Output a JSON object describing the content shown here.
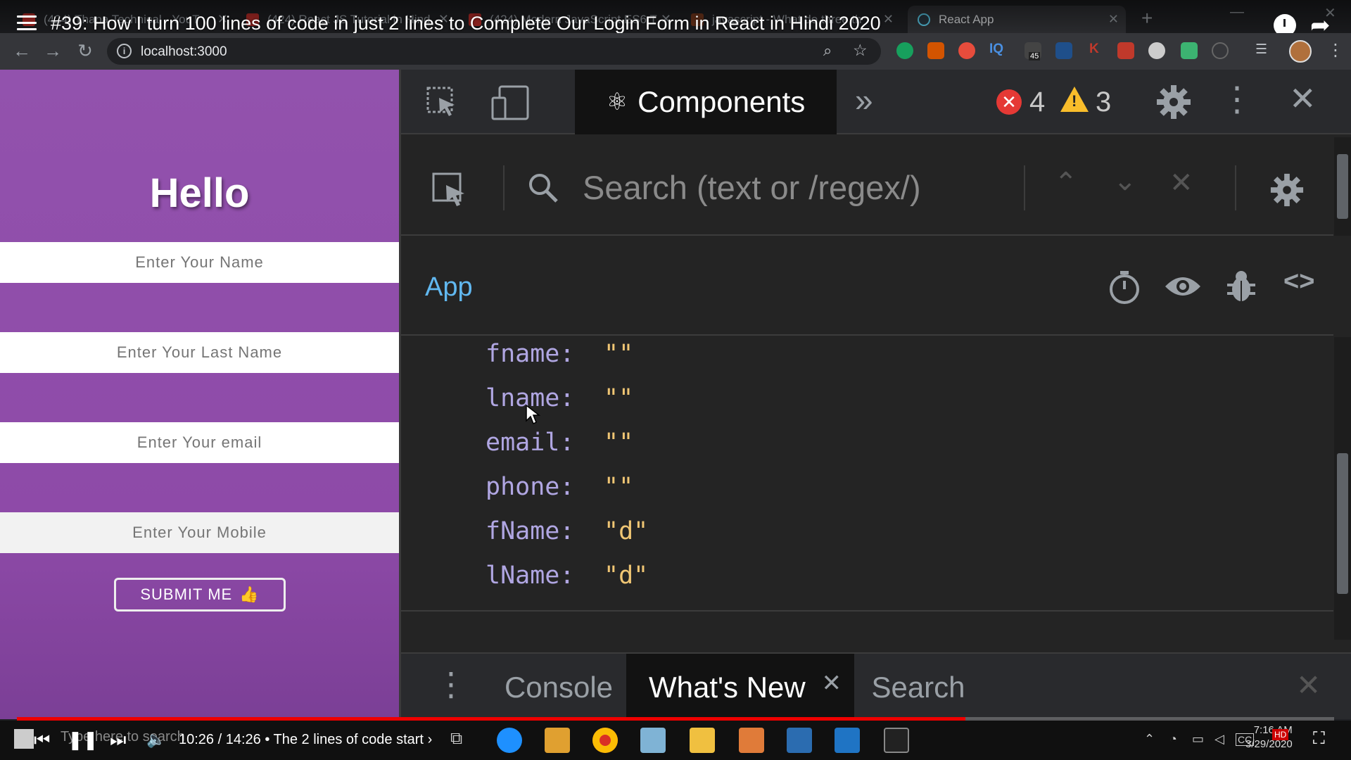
{
  "browser": {
    "tabs": [
      {
        "title": "(424) Thapa Technical - YouT",
        "icon": "youtube-favicon"
      },
      {
        "title": "(424) React JS Tutorial in Hind",
        "icon": "youtube-favicon"
      },
      {
        "title": "(424) Modern JavaScript ES6 T",
        "icon": "youtube-favicon"
      },
      {
        "title": "javascript - What do three th",
        "icon": "stackoverflow-favicon"
      },
      {
        "title": "React App",
        "icon": "react-favicon"
      }
    ],
    "url": "localhost:3000",
    "extension_badge": "45"
  },
  "video": {
    "title": "#39: How I turn 100 lines of code in just 2 lines to Complete Our Login Form in React in Hindi 2020",
    "time": "10:26 / 14:26",
    "chapter": "• The 2 lines of code start",
    "progress_fraction": 0.72,
    "search_hint": "Type here to search"
  },
  "app": {
    "heading": "Hello",
    "fields": [
      {
        "placeholder": "Enter Your Name"
      },
      {
        "placeholder": "Enter Your Last Name"
      },
      {
        "placeholder": "Enter Your email"
      },
      {
        "placeholder": "Enter Your Mobile"
      }
    ],
    "submit_label": "SUBMIT ME",
    "submit_emoji": "👍"
  },
  "devtools": {
    "active_tab": "Components",
    "error_count": "4",
    "warning_count": "3",
    "search_placeholder": "Search (text or /regex/)",
    "component_name": "App",
    "state": [
      {
        "key": "fname:",
        "value": "\"\""
      },
      {
        "key": "lname:",
        "value": "\"\""
      },
      {
        "key": "email:",
        "value": "\"\""
      },
      {
        "key": "phone:",
        "value": "\"\""
      },
      {
        "key": "fName:",
        "value": "\"d\""
      },
      {
        "key": "lName:",
        "value": "\"d\""
      }
    ],
    "drawer_tabs": [
      {
        "label": "Console"
      },
      {
        "label": "What's New"
      },
      {
        "label": "Search"
      }
    ]
  },
  "system": {
    "time": "7:16 AM",
    "date": "3/29/2020"
  },
  "colors": {
    "page_purple": "#9252ad",
    "devtools_bg": "#242424",
    "component_blue": "#61b8f0",
    "prop_key": "#b0a6e2",
    "prop_value": "#f0c674",
    "error_red": "#e53935",
    "warning_yellow": "#f9bd2b"
  }
}
